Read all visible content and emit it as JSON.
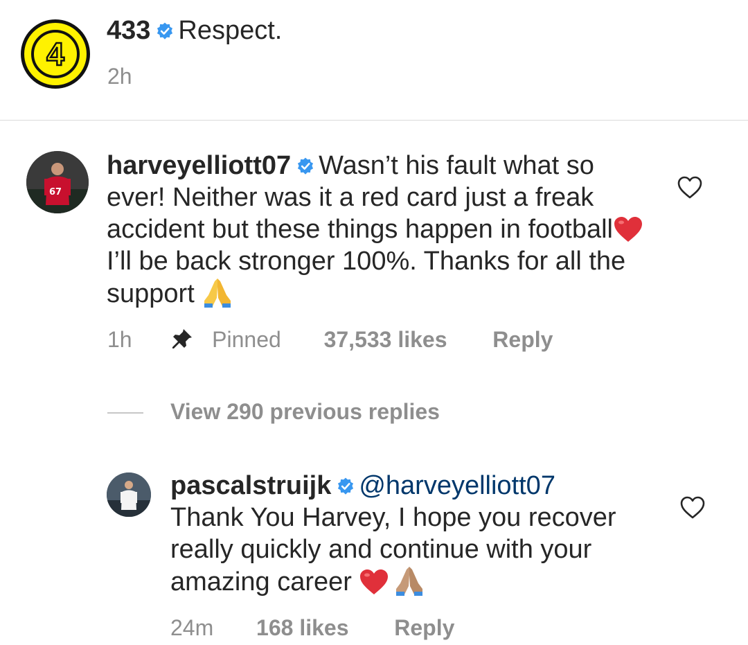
{
  "caption": {
    "avatar_glyph": "4",
    "username": "433",
    "text": "Respect.",
    "time": "2h"
  },
  "comments": [
    {
      "username": "harveyelliott07",
      "text_parts": [
        "Wasn’t his fault what so ever! Neither was it a red card just a freak accident but these things happen in football",
        " I’ll be back stronger 100%. Thanks for all the support "
      ],
      "time": "1h",
      "pinned_label": "Pinned",
      "likes": "37,533 likes",
      "reply_label": "Reply",
      "avatar_jersey_number": "67"
    },
    {
      "username": "pascalstruijk",
      "mention": "@harveyelliott07",
      "text": "Thank You Harvey, I hope you recover really quickly and continue with your amazing career ",
      "time": "24m",
      "likes": "168 likes",
      "reply_label": "Reply"
    }
  ],
  "view_replies": "View 290 previous replies",
  "icons": {
    "verified": "verified-badge-icon",
    "pin": "pin-icon",
    "like": "heart-outline-icon",
    "emoji_heart": "red-heart-emoji",
    "emoji_pray": "folded-hands-emoji"
  },
  "colors": {
    "text": "#262626",
    "secondary": "#8e8e8e",
    "verified_blue": "#3897f0",
    "mention": "#00376b",
    "emoji_red": "#e0303a",
    "brand_yellow": "#fff200"
  }
}
